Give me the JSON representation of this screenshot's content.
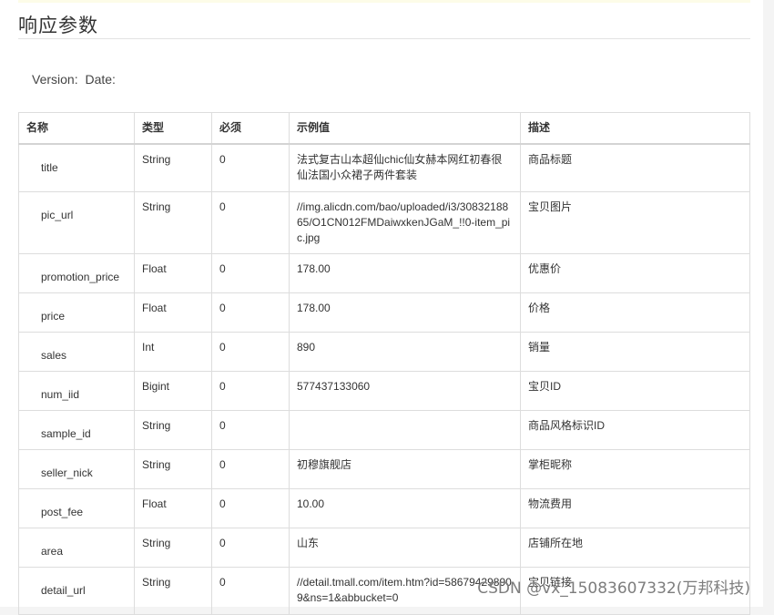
{
  "section": {
    "title": "响应参数"
  },
  "version_line": {
    "version_label": "Version:",
    "date_label": "Date:"
  },
  "table": {
    "headers": [
      "名称",
      "类型",
      "必须",
      "示例值",
      "描述"
    ],
    "rows": [
      {
        "name": "title",
        "type": "String",
        "required": "0",
        "example": "法式复古山本超仙chic仙女赫本网红初春很仙法国小众裙子两件套装",
        "desc": "商品标题"
      },
      {
        "name": "pic_url",
        "type": "String",
        "required": "0",
        "example": "//img.alicdn.com/bao/uploaded/i3/3083218865/O1CN012FMDaiwxkenJGaM_!!0-item_pic.jpg",
        "desc": "宝贝图片"
      },
      {
        "name": "promotion_price",
        "type": "Float",
        "required": "0",
        "example": "178.00",
        "desc": "优惠价"
      },
      {
        "name": "price",
        "type": "Float",
        "required": "0",
        "example": "178.00",
        "desc": "价格"
      },
      {
        "name": "sales",
        "type": "Int",
        "required": "0",
        "example": "890",
        "desc": "销量"
      },
      {
        "name": "num_iid",
        "type": "Bigint",
        "required": "0",
        "example": "577437133060",
        "desc": "宝贝ID"
      },
      {
        "name": "sample_id",
        "type": "String",
        "required": "0",
        "example": "",
        "desc": "商品风格标识ID"
      },
      {
        "name": "seller_nick",
        "type": "String",
        "required": "0",
        "example": "初穆旗舰店",
        "desc": "掌柜昵称"
      },
      {
        "name": "post_fee",
        "type": "Float",
        "required": "0",
        "example": "10.00",
        "desc": "物流费用"
      },
      {
        "name": "area",
        "type": "String",
        "required": "0",
        "example": "山东",
        "desc": "店铺所在地"
      },
      {
        "name": "detail_url",
        "type": "String",
        "required": "0",
        "example": "//detail.tmall.com/item.htm?id=586794298909&ns=1&abbucket=0",
        "desc": "宝贝链接"
      }
    ]
  },
  "watermark": {
    "text": "CSDN @vx_15083607332(万邦科技)"
  }
}
